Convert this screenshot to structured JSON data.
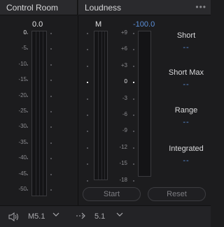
{
  "control_room": {
    "title": "Control Room",
    "value": "0.0",
    "scale": [
      "0",
      "-5",
      "-10",
      "-15",
      "-20",
      "-25",
      "-30",
      "-35",
      "-40",
      "-45",
      "-50"
    ]
  },
  "loudness": {
    "title": "Loudness",
    "menu": "•••",
    "channel_label": "M",
    "value": "-100.0",
    "scale": [
      "+9",
      "+6",
      "+3",
      "0",
      "-3",
      "-6",
      "-9",
      "-12",
      "-15",
      "-18"
    ],
    "stats": [
      {
        "label": "Short",
        "value": "--"
      },
      {
        "label": "Short Max",
        "value": "--"
      },
      {
        "label": "Range",
        "value": "--"
      },
      {
        "label": "Integrated",
        "value": "--"
      }
    ],
    "start_label": "Start",
    "reset_label": "Reset"
  },
  "footer": {
    "output_format": "M5.1",
    "target_format": "5.1",
    "speaker_icon": "speaker-icon",
    "route_icon": "dashed-arrow-icon",
    "chevron_icon": "chevron-down-icon"
  },
  "colors": {
    "accent": "#5b8fd9",
    "background": "#1c1c1e",
    "header": "#2a2a2d"
  }
}
